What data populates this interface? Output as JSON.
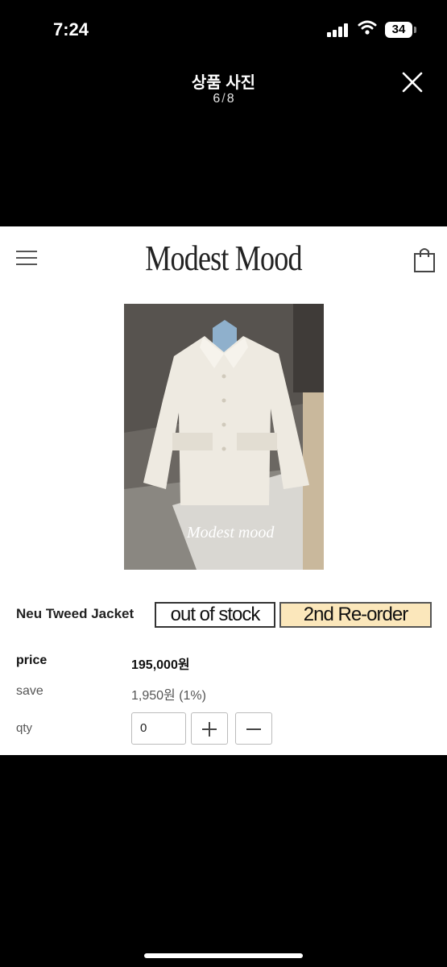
{
  "status_bar": {
    "time": "7:24",
    "battery": "34"
  },
  "viewer": {
    "title": "상품 사진",
    "current": "6",
    "separator": "/",
    "total": "8"
  },
  "shop": {
    "brand": "Modest Mood",
    "image_watermark": "Modest mood",
    "product_name": "Neu Tweed Jacket",
    "badges": {
      "stock": "out of stock",
      "reorder": "2nd Re-order"
    },
    "rows": {
      "price_label": "price",
      "price_value": "195,000원",
      "save_label": "save",
      "save_value": "1,950원 (1%)",
      "qty_label": "qty",
      "qty_value": "0"
    }
  },
  "colors": {
    "background": "#000000",
    "page": "#ffffff",
    "reorder_badge": "#fbe7bb"
  },
  "icons": [
    "signal-icon",
    "wifi-icon",
    "battery-icon",
    "close-icon",
    "menu-icon",
    "shopping-bag-icon",
    "plus-icon",
    "minus-icon"
  ]
}
